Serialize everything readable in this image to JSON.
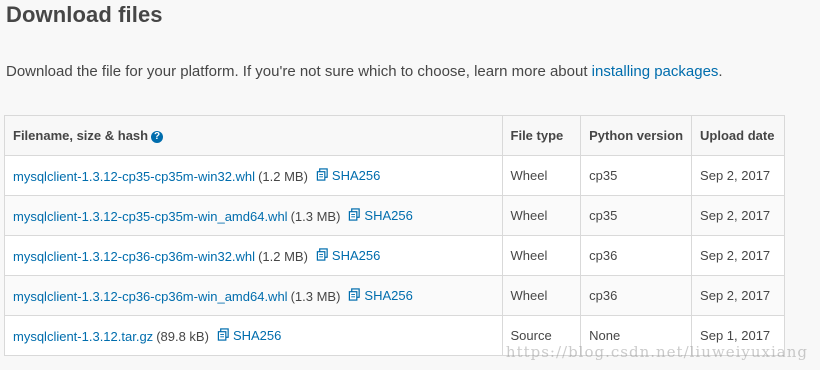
{
  "page": {
    "title": "Download files",
    "intro_text": "Download the file for your platform. If you're not sure which to choose, learn more about ",
    "intro_link": "installing packages",
    "intro_end": "."
  },
  "table": {
    "headers": {
      "filename": "Filename, size & hash",
      "file_type": "File type",
      "python_version": "Python version",
      "upload_date": "Upload date"
    },
    "hash_label": "SHA256",
    "rows": [
      {
        "filename": "mysqlclient-1.3.12-cp35-cp35m-win32.whl",
        "size": "(1.2 MB)",
        "file_type": "Wheel",
        "python_version": "cp35",
        "upload_date": "Sep 2, 2017"
      },
      {
        "filename": "mysqlclient-1.3.12-cp35-cp35m-win_amd64.whl",
        "size": "(1.3 MB)",
        "file_type": "Wheel",
        "python_version": "cp35",
        "upload_date": "Sep 2, 2017"
      },
      {
        "filename": "mysqlclient-1.3.12-cp36-cp36m-win32.whl",
        "size": "(1.2 MB)",
        "file_type": "Wheel",
        "python_version": "cp36",
        "upload_date": "Sep 2, 2017"
      },
      {
        "filename": "mysqlclient-1.3.12-cp36-cp36m-win_amd64.whl",
        "size": "(1.3 MB)",
        "file_type": "Wheel",
        "python_version": "cp36",
        "upload_date": "Sep 2, 2017"
      },
      {
        "filename": "mysqlclient-1.3.12.tar.gz",
        "size": "(89.8 kB)",
        "file_type": "Source",
        "python_version": "None",
        "upload_date": "Sep 1, 2017"
      }
    ]
  },
  "watermark": "https://blog.csdn.net/liuweiyuxiang",
  "colors": {
    "link": "#006dad",
    "text": "#464646",
    "border": "#d9d9d9",
    "background": "#f8f8f8"
  },
  "icons": {
    "help": "help-circle-icon",
    "hash": "copy-icon"
  }
}
